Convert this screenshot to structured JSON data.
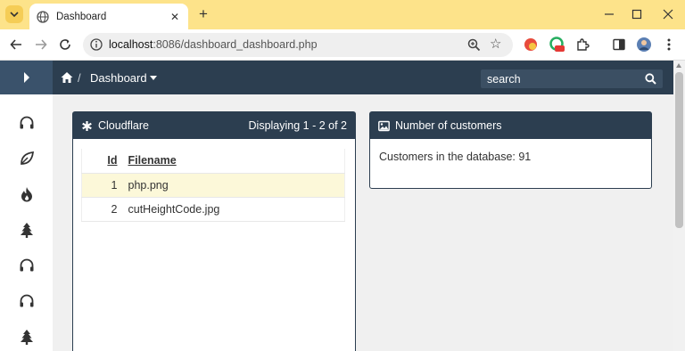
{
  "browser": {
    "tab_title": "Dashboard",
    "url_host": "localhost",
    "url_path": ":8086/dashboard_dashboard.php"
  },
  "app": {
    "breadcrumb": "Dashboard",
    "search_placeholder": "search",
    "sidebar_icons": [
      "headphones-icon",
      "leaf-icon",
      "fire-icon",
      "tree-icon",
      "headphones-icon",
      "headphones-icon",
      "tree-icon"
    ]
  },
  "cloudflare_panel": {
    "title": "Cloudflare",
    "count_text": "Displaying 1 - 2 of 2",
    "columns": [
      "Id",
      "Filename"
    ],
    "rows": [
      {
        "id": "1",
        "filename": "php.png"
      },
      {
        "id": "2",
        "filename": "cutHeightCode.jpg"
      }
    ]
  },
  "customers_panel": {
    "title": "Number of customers",
    "body": "Customers in the database: 91"
  },
  "colors": {
    "topbar": "#2c3e50",
    "tabstrip": "#fde38a",
    "row_highlight": "#fcf8d9"
  }
}
